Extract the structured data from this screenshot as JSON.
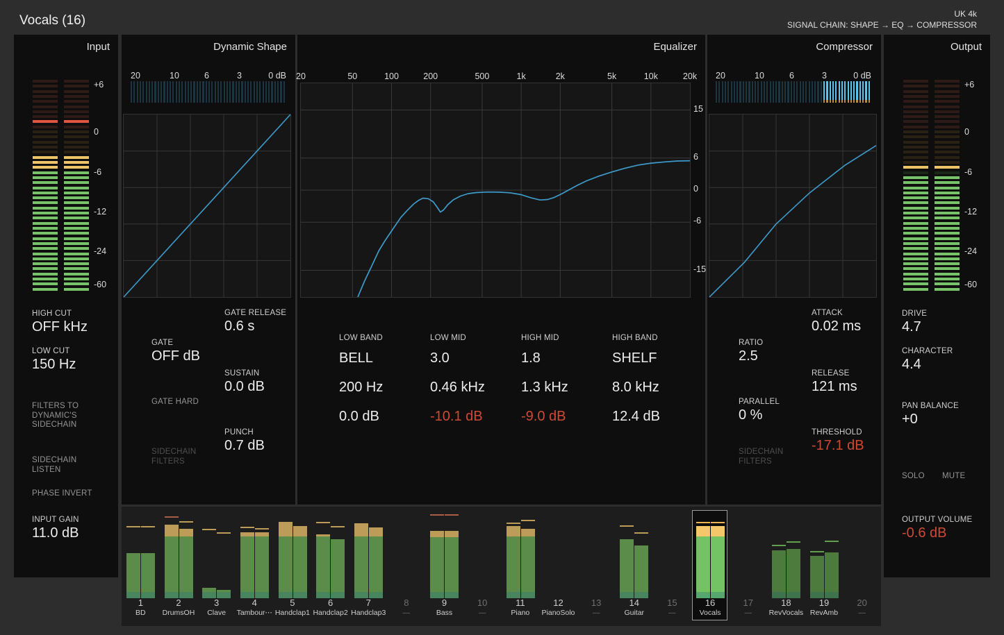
{
  "header": {
    "title": "Vocals (16)",
    "preset": "UK 4k",
    "signal_chain": "SIGNAL CHAIN: SHAPE → EQ → COMPRESSOR"
  },
  "input": {
    "title": "Input",
    "meter": {
      "scale": [
        "+6",
        "0",
        "-6",
        "-12",
        "-24",
        "-60"
      ],
      "level_db": -3.9,
      "peak_db": 1.0
    },
    "high_cut": {
      "label": "HIGH CUT",
      "value": "OFF kHz"
    },
    "low_cut": {
      "label": "LOW CUT",
      "value": "150 Hz"
    },
    "filters_to_sidechain": "FILTERS TO\nDYNAMIC'S\nSIDECHAIN",
    "sidechain_listen": "SIDECHAIN\nLISTEN",
    "phase_invert": "PHASE INVERT",
    "input_gain": {
      "label": "INPUT GAIN",
      "value": "11.0 dB"
    }
  },
  "shape": {
    "title": "Dynamic Shape",
    "gr_meter": {
      "scale": [
        "20",
        "10",
        "6",
        "3",
        "0 dB"
      ],
      "reduction_db": 0
    },
    "gate_release": {
      "label": "GATE RELEASE",
      "value": "0.6 s"
    },
    "gate": {
      "label": "GATE",
      "value": "OFF dB"
    },
    "sustain": {
      "label": "SUSTAIN",
      "value": "0.0 dB"
    },
    "gate_hard": "GATE HARD",
    "punch": {
      "label": "PUNCH",
      "value": "0.7 dB"
    },
    "sidechain_filters": "SIDECHAIN\nFILTERS"
  },
  "eq": {
    "title": "Equalizer",
    "freq_labels": [
      "20",
      "50",
      "100",
      "200",
      "500",
      "1k",
      "2k",
      "5k",
      "10k",
      "20k"
    ],
    "freq_values": [
      20,
      50,
      100,
      200,
      500,
      1000,
      2000,
      5000,
      10000,
      20000
    ],
    "gain_labels": [
      "15",
      "6",
      "0",
      "-6",
      "-15"
    ],
    "gain_values": [
      15,
      6,
      0,
      -6,
      -15
    ],
    "bands": [
      {
        "label": "LOW BAND",
        "type": "BELL",
        "freq": "200 Hz",
        "gain": "0.0 dB"
      },
      {
        "label": "LOW MID",
        "type": "3.0",
        "freq": "0.46 kHz",
        "gain": "-10.1 dB"
      },
      {
        "label": "HIGH MID",
        "type": "1.8",
        "freq": "1.3 kHz",
        "gain": "-9.0 dB"
      },
      {
        "label": "HIGH BAND",
        "type": "SHELF",
        "freq": "8.0 kHz",
        "gain": "12.4 dB"
      }
    ]
  },
  "compressor": {
    "title": "Compressor",
    "gr_meter": {
      "scale": [
        "20",
        "10",
        "6",
        "3",
        "0 dB"
      ],
      "reduction_db": 3
    },
    "attack": {
      "label": "ATTACK",
      "value": "0.02 ms"
    },
    "ratio": {
      "label": "RATIO",
      "value": "2.5"
    },
    "release": {
      "label": "RELEASE",
      "value": "121 ms"
    },
    "parallel": {
      "label": "PARALLEL",
      "value": "0 %"
    },
    "threshold": {
      "label": "THRESHOLD",
      "value": "-17.1 dB"
    },
    "sidechain_filters": "SIDECHAIN\nFILTERS"
  },
  "output": {
    "title": "Output",
    "meter": {
      "scale": [
        "+6",
        "0",
        "-6",
        "-12",
        "-24",
        "-60"
      ],
      "level_db": -6.7,
      "peak_db": -5.5
    },
    "drive": {
      "label": "DRIVE",
      "value": "4.7"
    },
    "character": {
      "label": "CHARACTER",
      "value": "4.4"
    },
    "pan_balance": {
      "label": "PAN BALANCE",
      "value": "+0"
    },
    "solo": "SOLO",
    "mute": "MUTE",
    "output_volume": {
      "label": "OUTPUT VOLUME",
      "value": "-0.6 dB"
    }
  },
  "mixer": {
    "channels": [
      {
        "num": "1",
        "name": "BD",
        "left": {
          "level": 0.533,
          "peak": 0.836,
          "peak_color": "tan"
        },
        "right": {
          "level": 0.533,
          "peak": 0.836,
          "peak_color": "tan"
        }
      },
      {
        "num": "2",
        "name": "DrumsOH",
        "left": {
          "level": 0.73,
          "cap": 0.87,
          "peak": 0.95,
          "peak_color": "red"
        },
        "right": {
          "level": 0.73,
          "cap": 0.82,
          "peak": 0.89,
          "peak_color": "tan"
        }
      },
      {
        "num": "3",
        "name": "Clave",
        "left": {
          "level": 0.123,
          "peak": 0.8,
          "peak_color": "tan"
        },
        "right": {
          "level": 0.098,
          "peak": 0.762,
          "peak_color": "tan"
        }
      },
      {
        "num": "4",
        "name": "Tambour⋯",
        "left": {
          "level": 0.73,
          "cap": 0.78,
          "peak": 0.825,
          "peak_color": "tan"
        },
        "right": {
          "level": 0.73,
          "cap": 0.775,
          "peak": 0.815,
          "peak_color": "tan"
        }
      },
      {
        "num": "5",
        "name": "Handclap1",
        "left": {
          "level": 0.73,
          "cap": 0.9
        },
        "right": {
          "level": 0.73,
          "cap": 0.852
        }
      },
      {
        "num": "6",
        "name": "Handclap2",
        "left": {
          "level": 0.73,
          "cap": 0.754,
          "peak": 0.885,
          "peak_color": "tan"
        },
        "right": {
          "level": 0.697,
          "peak": 0.836,
          "peak_color": "tan"
        }
      },
      {
        "num": "7",
        "name": "Handclap3",
        "left": {
          "level": 0.73,
          "cap": 0.885
        },
        "right": {
          "level": 0.73,
          "cap": 0.836
        }
      },
      {
        "num": "8",
        "name": "—",
        "empty": true
      },
      {
        "num": "9",
        "name": "Bass",
        "left": {
          "level": 0.72,
          "cap": 0.795,
          "peak": 0.975,
          "peak_color": "red"
        },
        "right": {
          "level": 0.72,
          "cap": 0.795,
          "peak": 0.975,
          "peak_color": "red"
        }
      },
      {
        "num": "10",
        "name": "—",
        "empty": true
      },
      {
        "num": "11",
        "name": "Piano",
        "left": {
          "level": 0.73,
          "cap": 0.855,
          "peak": 0.875,
          "peak_color": "tan"
        },
        "right": {
          "level": 0.73,
          "cap": 0.82,
          "peak": 0.91,
          "peak_color": "tan"
        }
      },
      {
        "num": "12",
        "name": "PianoSolo"
      },
      {
        "num": "13",
        "name": "—",
        "empty": true
      },
      {
        "num": "14",
        "name": "Guitar",
        "left": {
          "level": 0.7,
          "peak": 0.842,
          "peak_color": "tan"
        },
        "right": {
          "level": 0.625,
          "peak": 0.76,
          "peak_color": "tan"
        }
      },
      {
        "num": "15",
        "name": "—",
        "empty": true
      },
      {
        "num": "16",
        "name": "Vocals",
        "selected": true,
        "variant": "selected",
        "left": {
          "level": 0.73,
          "cap": 0.852,
          "peak": 0.885,
          "peak_color": "orange"
        },
        "right": {
          "level": 0.73,
          "cap": 0.852,
          "peak": 0.885,
          "peak_color": "orange"
        }
      },
      {
        "num": "17",
        "name": "—",
        "empty": true
      },
      {
        "num": "18",
        "name": "RevVocals",
        "variant": "rev",
        "left": {
          "level": 0.565,
          "peak": 0.617,
          "peak_color": "green"
        },
        "right": {
          "level": 0.584,
          "peak": 0.653,
          "peak_color": "green"
        }
      },
      {
        "num": "19",
        "name": "RevAmb",
        "variant": "rev",
        "left": {
          "level": 0.502,
          "peak": 0.54,
          "peak_color": "green"
        },
        "right": {
          "level": 0.543,
          "peak": 0.664,
          "peak_color": "green"
        }
      },
      {
        "num": "20",
        "name": "—",
        "empty": true
      }
    ]
  },
  "chart_data": [
    {
      "id": "shape_transfer",
      "type": "line",
      "title": "Dynamic Shape transfer curve (1:1 diagonal, 5x5 grid)",
      "points_norm": [
        [
          0,
          0
        ],
        [
          1,
          1
        ]
      ]
    },
    {
      "id": "eq_response",
      "type": "line",
      "title": "Equalizer frequency response",
      "x_scale": "log",
      "x_range_hz": [
        20,
        20000
      ],
      "y_range_db": [
        -20,
        20
      ],
      "grid_freqs_hz": [
        20,
        50,
        100,
        200,
        500,
        1000,
        2000,
        5000,
        10000,
        20000
      ],
      "grid_gains_db": [
        15,
        6,
        0,
        -6,
        -15
      ],
      "points_hz_db": [
        [
          55,
          -20
        ],
        [
          62,
          -17
        ],
        [
          70,
          -14.3
        ],
        [
          80,
          -11.3
        ],
        [
          90,
          -9.3
        ],
        [
          103,
          -7.2
        ],
        [
          118,
          -5.1
        ],
        [
          132,
          -3.8
        ],
        [
          148,
          -2.6
        ],
        [
          162,
          -1.9
        ],
        [
          175,
          -1.5
        ],
        [
          192,
          -1.6
        ],
        [
          210,
          -2.2
        ],
        [
          225,
          -3.2
        ],
        [
          238,
          -4.1
        ],
        [
          252,
          -3.7
        ],
        [
          272,
          -2.7
        ],
        [
          300,
          -1.8
        ],
        [
          340,
          -1.1
        ],
        [
          390,
          -0.65
        ],
        [
          450,
          -0.45
        ],
        [
          550,
          -0.35
        ],
        [
          680,
          -0.38
        ],
        [
          820,
          -0.5
        ],
        [
          1000,
          -0.85
        ],
        [
          1200,
          -1.45
        ],
        [
          1400,
          -1.85
        ],
        [
          1600,
          -1.75
        ],
        [
          1800,
          -1.35
        ],
        [
          2050,
          -0.7
        ],
        [
          2350,
          0.1
        ],
        [
          2700,
          0.9
        ],
        [
          3200,
          1.75
        ],
        [
          4000,
          2.65
        ],
        [
          5000,
          3.4
        ],
        [
          6300,
          4.1
        ],
        [
          8000,
          4.7
        ],
        [
          10000,
          5.05
        ],
        [
          13000,
          5.3
        ],
        [
          16000,
          5.45
        ],
        [
          20000,
          5.5
        ]
      ]
    },
    {
      "id": "comp_transfer",
      "type": "line",
      "title": "Compressor transfer curve (soft knee, ratio 2.5)",
      "points_norm": [
        [
          0,
          0
        ],
        [
          0.21,
          0.19
        ],
        [
          0.4,
          0.4
        ],
        [
          0.6,
          0.57
        ],
        [
          0.81,
          0.72
        ],
        [
          1,
          0.83
        ]
      ]
    }
  ],
  "colors": {
    "accent_curve": "#3e9ccd",
    "meter_lit_cyan": "#58c4ef",
    "meter_green": "#78c369",
    "meter_yellow": "#eec468",
    "meter_red": "#e25540",
    "negative_value_red": "#cd4a33"
  }
}
